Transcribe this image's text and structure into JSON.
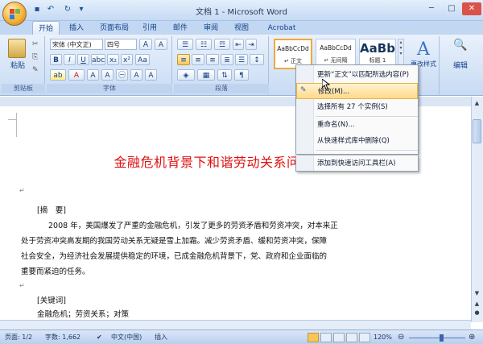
{
  "window": {
    "title": "文档 1 - Microsoft Word",
    "controls": [
      "─",
      "□",
      "✕"
    ]
  },
  "qat": {
    "save": "▪",
    "undo": "↶",
    "redo": "↻",
    "more": "▾"
  },
  "tabs": [
    "开始",
    "插入",
    "页面布局",
    "引用",
    "邮件",
    "审阅",
    "视图",
    "Acrobat"
  ],
  "ribbon": {
    "clipboard": {
      "paste": "粘贴",
      "label": "剪贴板"
    },
    "font": {
      "name": "宋体 (中文正)",
      "size": "四号",
      "label": "字体"
    },
    "paragraph": {
      "label": "段落"
    },
    "styles": {
      "boxes": [
        {
          "preview": "AaBbCcDd",
          "name": "↵ 正文"
        },
        {
          "preview": "AaBbCcDd",
          "name": "↵ 无间隔"
        },
        {
          "preview": "AaBb",
          "name": "标题 1"
        }
      ],
      "change": "更改样式"
    },
    "editing": {
      "label": "编辑"
    }
  },
  "context_menu": {
    "items": [
      "更新“正文”以匹配所选内容(P)",
      "修改(M)...",
      "选择所有 27 个实例(S)",
      "重命名(N)...",
      "从快速样式库中删除(Q)",
      "添加到快速访问工具栏(A)"
    ]
  },
  "document": {
    "heading": "金融危机背景下和谐劳动关系问题的思考",
    "abstract_label": "[摘　要]",
    "abstract_lines": [
      "2008 年，美国爆发了严重的金融危机，引发了更多的劳资矛盾和劳资冲突，对本来正",
      "处于劳资冲突高发期的我国劳动关系无疑是雪上加霜。减少劳资矛盾、缓和劳资冲突，保障",
      "社会安全，为经济社会发展提供稳定的环境，已成金融危机背景下，党、政府和企业面临的",
      "重要而紧迫的任务。"
    ],
    "keywords_label": "[关键词]",
    "keywords": "金融危机；劳资关系；对策"
  },
  "status": {
    "page": "页面: 1/2",
    "words": "字数: 1,662",
    "language": "中文(中国)",
    "mode": "插入",
    "zoom": "120%"
  },
  "colors": {
    "heading": "#e01010",
    "ribbon": "#c8dbf3",
    "accent": "#f1a83b"
  }
}
